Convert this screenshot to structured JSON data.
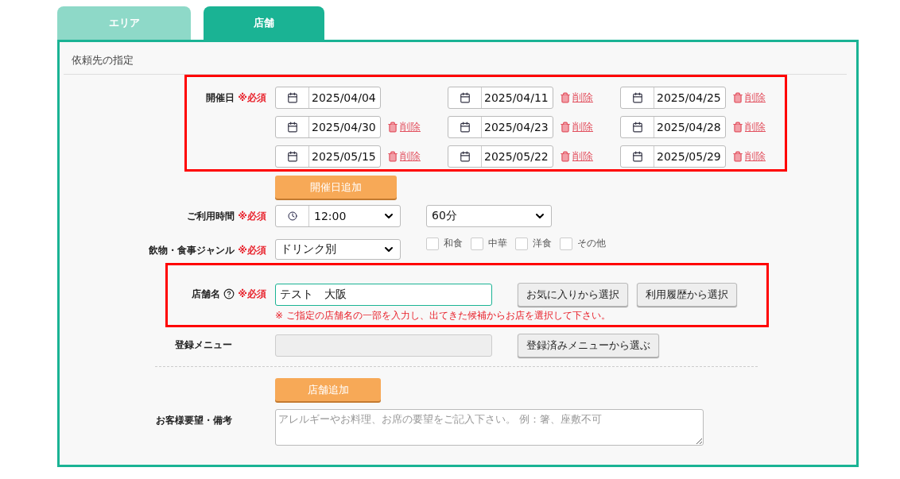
{
  "tabs": [
    {
      "label": "エリア",
      "selected": false
    },
    {
      "label": "店舗",
      "selected": true
    }
  ],
  "section_title": "依頼先の指定",
  "event_dates": {
    "label": "開催日",
    "required": "※必須",
    "highlighted": true,
    "dates": [
      {
        "date": "2025/04/04"
      },
      {
        "date": "2025/04/11",
        "delete": "削除"
      },
      {
        "date": "2025/04/25",
        "delete": "削除"
      },
      {
        "date": "2025/04/30",
        "delete": "削除"
      },
      {
        "date": "2025/04/23",
        "delete": "削除"
      },
      {
        "date": "2025/04/28",
        "delete": "削除"
      },
      {
        "date": "2025/05/15",
        "delete": "削除"
      },
      {
        "date": "2025/05/22",
        "delete": "削除"
      },
      {
        "date": "2025/05/29",
        "delete": "削除"
      }
    ],
    "add_button": "開催日追加"
  },
  "usage_time": {
    "label": "ご利用時間",
    "required": "※必須",
    "time": "12:00",
    "duration": "60分"
  },
  "genre": {
    "label": "飲物・食事ジャンル",
    "required": "※必須",
    "drink": "ドリンク別",
    "cuisines": [
      {
        "label": "和食",
        "checked": false
      },
      {
        "label": "中華",
        "checked": false
      },
      {
        "label": "洋食",
        "checked": false
      },
      {
        "label": "その他",
        "checked": false
      }
    ]
  },
  "shop_name": {
    "label": "店舗名",
    "required": "※必須",
    "highlighted": true,
    "value": "テスト　大阪",
    "buttons": [
      "お気に入りから選択",
      "利用履歴から選択"
    ],
    "hint": "※ ご指定の店舗名の一部を入力し、出てきた候補からお店を選択して下さい。"
  },
  "menu": {
    "label": "登録メニュー",
    "button": "登録済みメニューから選ぶ"
  },
  "add_shop_button": "店舗追加",
  "remarks": {
    "label": "お客様要望・備考",
    "placeholder": "アレルギーやお料理、お席の要望をご記入下さい。 例：箸、座敷不可"
  }
}
